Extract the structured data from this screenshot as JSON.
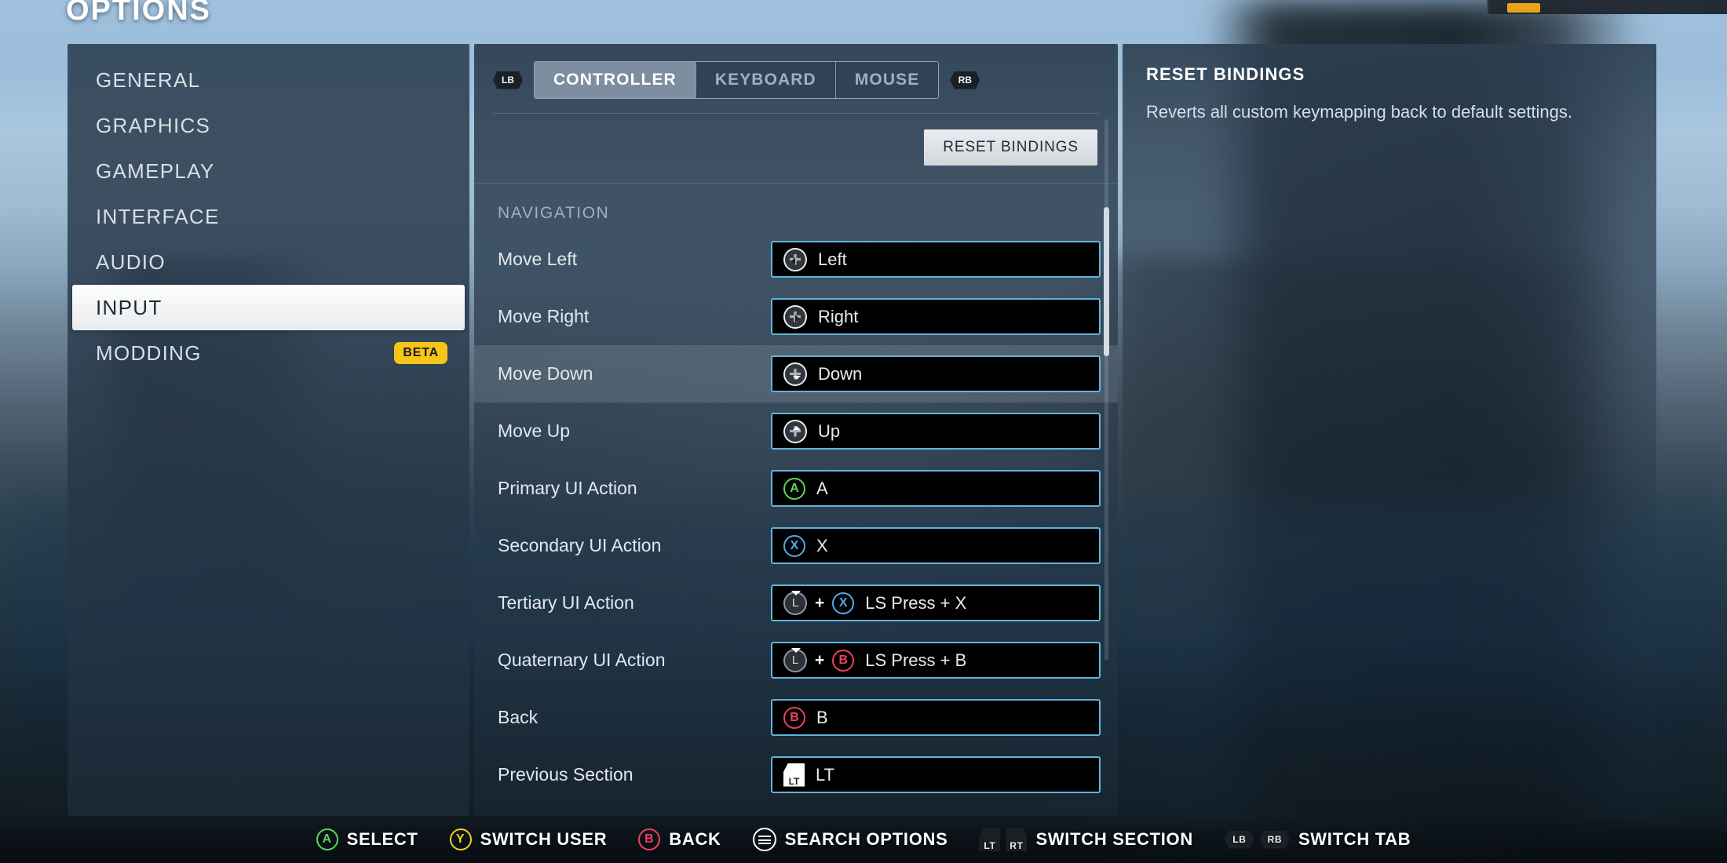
{
  "page_title": "OPTIONS",
  "sidebar": {
    "items": [
      {
        "label": "GENERAL",
        "selected": false,
        "badge": null
      },
      {
        "label": "GRAPHICS",
        "selected": false,
        "badge": null
      },
      {
        "label": "GAMEPLAY",
        "selected": false,
        "badge": null
      },
      {
        "label": "INTERFACE",
        "selected": false,
        "badge": null
      },
      {
        "label": "AUDIO",
        "selected": false,
        "badge": null
      },
      {
        "label": "INPUT",
        "selected": true,
        "badge": null
      },
      {
        "label": "MODDING",
        "selected": false,
        "badge": "BETA"
      }
    ]
  },
  "main": {
    "tab_prev_icon": "lb-bumper-icon",
    "tab_next_icon": "rb-bumper-icon",
    "tabs": [
      {
        "label": "CONTROLLER",
        "active": true
      },
      {
        "label": "KEYBOARD",
        "active": false
      },
      {
        "label": "MOUSE",
        "active": false
      }
    ],
    "reset_button_label": "RESET BINDINGS",
    "section_label": "NAVIGATION",
    "bindings": [
      {
        "label": "Move Left",
        "value": "Left",
        "focused": false,
        "glyphs": [
          {
            "type": "dpad",
            "dir": "left"
          }
        ]
      },
      {
        "label": "Move Right",
        "value": "Right",
        "focused": false,
        "glyphs": [
          {
            "type": "dpad",
            "dir": "right"
          }
        ]
      },
      {
        "label": "Move Down",
        "value": "Down",
        "focused": true,
        "glyphs": [
          {
            "type": "dpad",
            "dir": "down"
          }
        ]
      },
      {
        "label": "Move Up",
        "value": "Up",
        "focused": false,
        "glyphs": [
          {
            "type": "dpad",
            "dir": "up"
          }
        ]
      },
      {
        "label": "Primary UI Action",
        "value": "A",
        "focused": false,
        "glyphs": [
          {
            "type": "face",
            "key": "A"
          }
        ]
      },
      {
        "label": "Secondary UI Action",
        "value": "X",
        "focused": false,
        "glyphs": [
          {
            "type": "face",
            "key": "X"
          }
        ]
      },
      {
        "label": "Tertiary UI Action",
        "value": "LS Press + X",
        "focused": false,
        "glyphs": [
          {
            "type": "stick",
            "key": "L"
          },
          {
            "type": "plus"
          },
          {
            "type": "face",
            "key": "X"
          }
        ]
      },
      {
        "label": "Quaternary UI Action",
        "value": "LS Press + B",
        "focused": false,
        "glyphs": [
          {
            "type": "stick",
            "key": "L"
          },
          {
            "type": "plus"
          },
          {
            "type": "face",
            "key": "B"
          }
        ]
      },
      {
        "label": "Back",
        "value": "B",
        "focused": false,
        "glyphs": [
          {
            "type": "face",
            "key": "B"
          }
        ]
      },
      {
        "label": "Previous Section",
        "value": "LT",
        "focused": false,
        "glyphs": [
          {
            "type": "trigger",
            "key": "LT"
          }
        ]
      }
    ]
  },
  "info": {
    "title": "RESET BINDINGS",
    "description": "Reverts all custom keymapping back to default settings."
  },
  "action_bar": [
    {
      "label": "SELECT",
      "glyphs": [
        {
          "type": "face",
          "key": "A"
        }
      ]
    },
    {
      "label": "SWITCH USER",
      "glyphs": [
        {
          "type": "face",
          "key": "Y"
        }
      ]
    },
    {
      "label": "BACK",
      "glyphs": [
        {
          "type": "face",
          "key": "B"
        }
      ]
    },
    {
      "label": "SEARCH OPTIONS",
      "glyphs": [
        {
          "type": "menu"
        }
      ]
    },
    {
      "label": "SWITCH SECTION",
      "glyphs": [
        {
          "type": "trigger",
          "key": "LT"
        },
        {
          "type": "trigger",
          "key": "RT"
        }
      ]
    },
    {
      "label": "SWITCH TAB",
      "glyphs": [
        {
          "type": "bumper",
          "key": "LB"
        },
        {
          "type": "bumper",
          "key": "RB"
        }
      ]
    }
  ],
  "colors": {
    "accent_field_border": "#63b4dc",
    "badge_beta": "#f5c518",
    "button_a": "#5fd35f",
    "button_b": "#ef3f5c",
    "button_x": "#52a9e8",
    "button_y": "#f2d024",
    "selected_item_bg": "#fdfdfd"
  }
}
